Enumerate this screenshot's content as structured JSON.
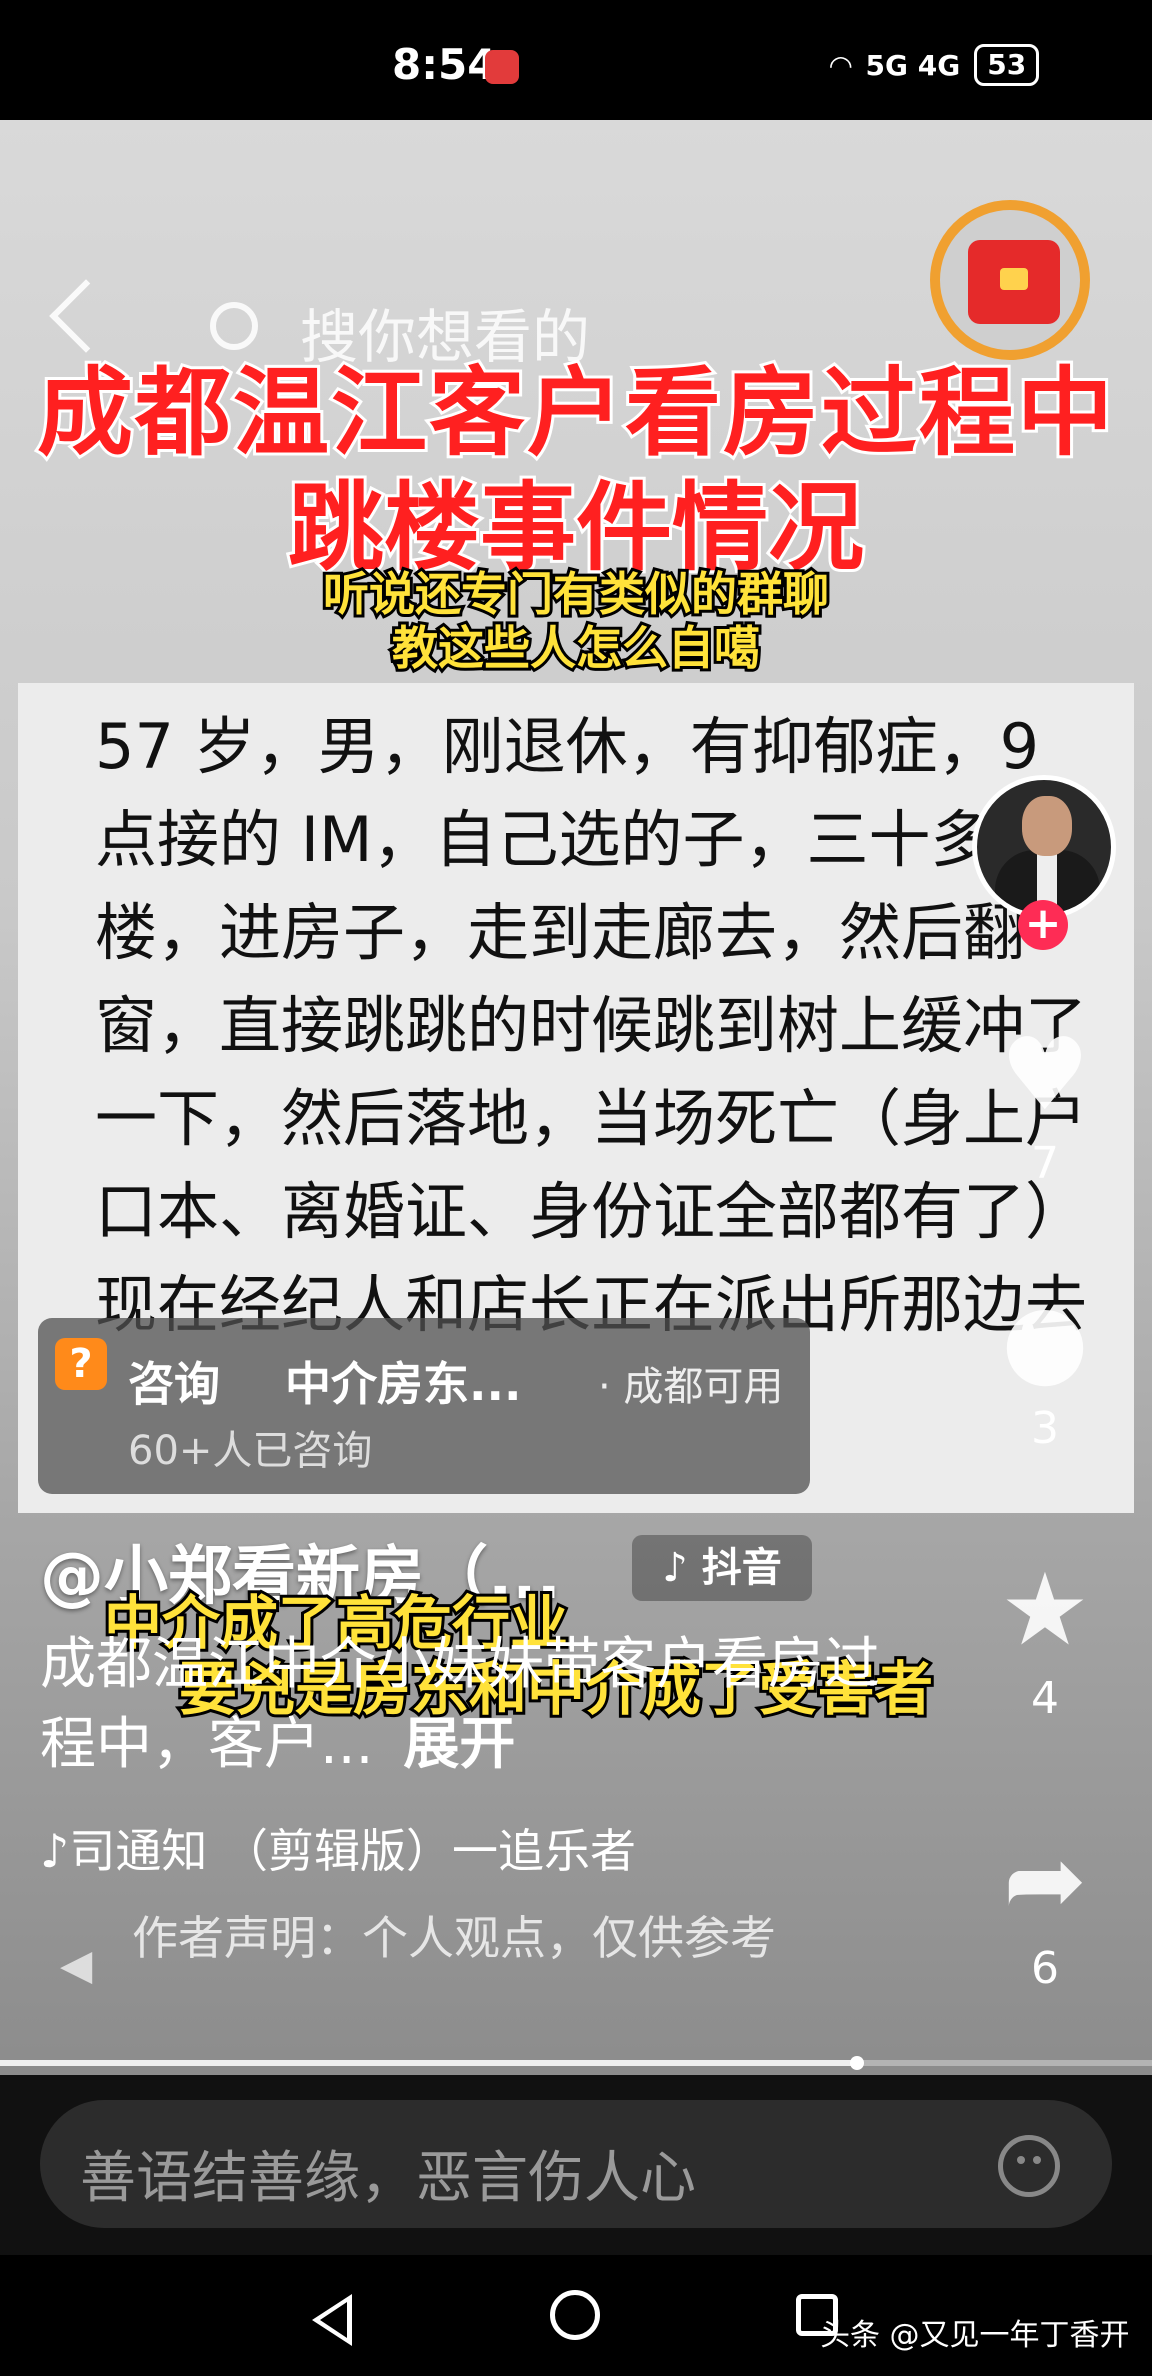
{
  "status_bar": {
    "time": "8:54",
    "network": "5G 4G",
    "battery": "53"
  },
  "search": {
    "placeholder": "搜你想看的"
  },
  "video": {
    "title_line1": "成都温江客户看房过程中",
    "title_line2": "跳楼事件情况",
    "subtitle_line1": "听说还专门有类似的群聊",
    "subtitle_line2": "教这些人怎么自噶",
    "body_text": "57 岁，男，刚退休，有抑郁症，9 点接的 IM，自己选的子，三十多楼，进房子，走到走廊去，然后翻窗，直接跳跳的时候跳到树上缓冲了一下，然后落地，当场死亡（身上户口本、离婚证、身份证全部都有了）现在经纪人和店长正在派出所那边去",
    "overlay_line1": "中介成了高危行业",
    "overlay_line2": "要兇是房东和中介成了受害者"
  },
  "side_actions": {
    "like_count": "7",
    "comment_count": "3",
    "favorite_count": "4",
    "share_count": "6"
  },
  "consult_card": {
    "label": "咨询",
    "title": "中介房东...",
    "location": "· 成都可用",
    "count": "60+人已咨询"
  },
  "post": {
    "author": "@小郑看新房（...",
    "platform_tag": "抖音",
    "description": "成都温江中介小妹妹带客户看房过程中，客户...",
    "expand_label": "展开",
    "music": "司通知 （剪辑版）一追乐者",
    "notice": "作者声明：个人观点，仅供参考",
    "progress": 0.74
  },
  "comment_bar": {
    "placeholder": "善语结善缘，恶言伤人心"
  },
  "watermark": "头条 @又见一年丁香开"
}
